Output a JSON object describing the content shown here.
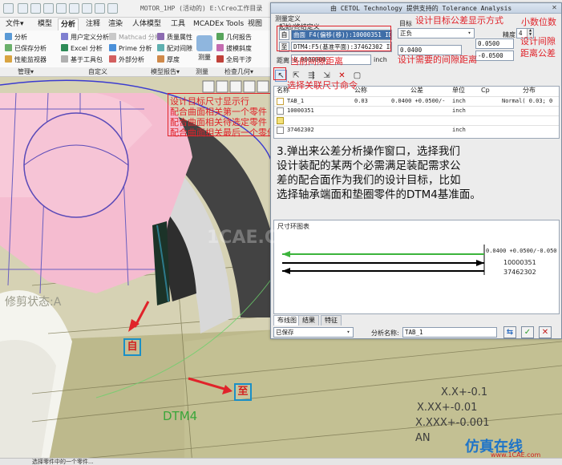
{
  "window": {
    "title": "MOTOR_1HP (活动的) E:\\Creo工作目录",
    "quick_access_icons": [
      "new-file-icon",
      "open-file-icon",
      "save-icon",
      "undo-icon",
      "redo-icon",
      "regenerate-icon",
      "window-icon",
      "close-window-icon"
    ]
  },
  "ribbon": {
    "tabs": [
      "文件▾",
      "模型",
      "分析",
      "注释",
      "渲染",
      "人体模型",
      "工具",
      "MCADEx Tools",
      "视图"
    ],
    "active_tab": "分析",
    "commands": {
      "analysis": "分析",
      "saved_analysis": "已保存分析",
      "perf_monitor": "性能监视器",
      "user_defined": "用户定义分析",
      "excel": "Excel 分析",
      "toolbar_based": "基于工具包",
      "mathcad": "Mathcad 分析",
      "prime": "Prime 分析",
      "external": "外部分析",
      "measure": "测量",
      "mass_props": "质量属性",
      "pairs_clearance": "配对间隙",
      "thickness": "厚度",
      "measure_big": "测量",
      "geom_report": "几何报告",
      "draft": "拔模斜度",
      "global_interference": "全局干涉"
    },
    "groups": {
      "manage": "管理▾",
      "custom": "自定义",
      "model_report": "模型报告▾",
      "measure": "测量",
      "inspect_geometry": "检查几何▾"
    }
  },
  "dialog": {
    "title": "由 CETOL Technology 提供支持的 Tolerance Analysis",
    "measure_def_label": "测量定义",
    "from_to_label": "起始/终结定义",
    "from_tag": "自",
    "to_tag": "至",
    "from_value": "曲面 F4(偏移(移)):10000351 ID=725",
    "to_value": "DTM4:F5(基准平面):37462302 ID=21",
    "distance_label": "距离",
    "distance_value": "0.0000000",
    "distance_unit": "inch",
    "target_label": "目标",
    "target_value": "正负",
    "precision_label": "精度",
    "precision_value": "4",
    "target_number": "0.0400",
    "upper_tol": "0.0500",
    "lower_tol": "-0.0500",
    "table": {
      "headers": [
        "名称",
        "公称",
        "公差",
        "单位",
        "Cp",
        "分布"
      ],
      "rows": [
        [
          "TAB_1",
          "0.03",
          "0.0400 +0.0500/-",
          "inch",
          "",
          "Normal( 0.03; 0"
        ],
        [
          "10000351",
          "",
          "",
          "inch",
          "",
          ""
        ],
        [
          "",
          "",
          "",
          "",
          "",
          ""
        ],
        [
          "37462302",
          "",
          "",
          "inch",
          "",
          ""
        ]
      ]
    },
    "chain_label": "尺寸环图表",
    "chain_top_label": "0.0400 +0.0500/-0.050",
    "chain_part1": "10000351",
    "chain_part2": "37462302",
    "bottom_tabs": [
      "布线图",
      "结果",
      "特征"
    ],
    "save_state": "已保存",
    "analysis_name_label": "分析名称:",
    "analysis_name": "TAB_1"
  },
  "annotations": {
    "design_target_format": "设计目标公差显示方式",
    "decimal_places": "小数位数",
    "design_gap_dist1": "设计间隙",
    "design_gap_dist2": "距离公差",
    "current_gap": "当前间隙距离",
    "design_required_gap": "设计需要的间隙距离",
    "select_related_dims": "选择关联尺寸命令",
    "target_row": "设计目标尺寸显示行",
    "first_part": "配合曲面相关第一个零件",
    "pending_part": "配合曲面相关待选定零件",
    "last_part": "配合曲面相关最后一个零件",
    "chip_from": "自",
    "chip_to": "至",
    "dtm_label": "DTM4",
    "trim_state": "修剪状态:A"
  },
  "instruction": [
    "3.弹出来公差分析操作窗口，选择我们",
    "设计装配的某两个必需满足装配需求公",
    "差的配合面作为我们的设计目标，比如",
    "选择轴承端面和垫圈零件的DTM4基准面。"
  ],
  "gdt_text": [
    "X.X+-0.1",
    "X.XX+-0.01",
    "X.XXX+-0.001",
    "AN"
  ],
  "watermark": {
    "center": "1CAE.COM",
    "brand": "仿真在线",
    "url": "www.1CAE.com"
  },
  "status_bar": "选择零件中的一个零件..."
}
